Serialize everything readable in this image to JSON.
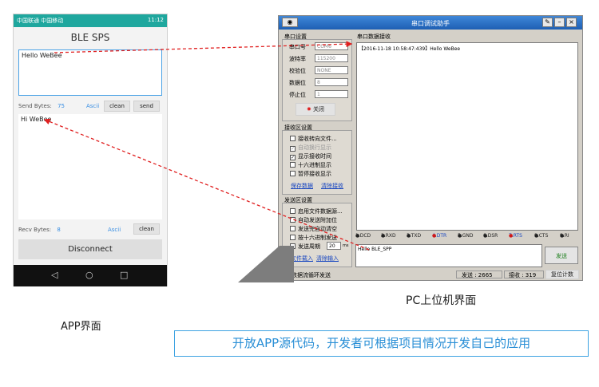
{
  "phone": {
    "status_left": "中国联通 中国移动",
    "status_right": "11:12",
    "title": "BLE SPS",
    "send_text": "Hello WeBee",
    "send_bytes_label": "Send Bytes:",
    "send_bytes_value": "75",
    "ascii_label": "Ascii",
    "clean_label": "clean",
    "send_label": "send",
    "recv_text": "Hi WeBee",
    "recv_bytes_label": "Recv Bytes:",
    "recv_bytes_value": "8",
    "recv_ascii_label": "Ascii",
    "recv_clean_label": "clean",
    "disconnect_label": "Disconnect",
    "nav": [
      "◁",
      "○",
      "□"
    ]
  },
  "app_label": "APP界面",
  "pc": {
    "title": "串口调试助手",
    "port_group": "串口设置",
    "port_label": "串口号",
    "port_value": "COM6",
    "baud_label": "波特率",
    "baud_value": "115200",
    "parity_label": "校验位",
    "parity_value": "NONE",
    "data_label": "数据位",
    "data_value": "8",
    "stop_label": "停止位",
    "stop_value": "1",
    "close_label": "关闭",
    "recv_group": "接收区设置",
    "recv_opts": [
      "接收转向文件...",
      "自动换行显示",
      "显示接收时间",
      "十六进制显示",
      "暂停接收显示"
    ],
    "recv_links": [
      "保存数据",
      "清除接收"
    ],
    "send_group": "发送区设置",
    "send_opts": [
      "启用文件数据源...",
      "自动发送附加位",
      "发送完自动清空",
      "按十六进制发送",
      "发送周期"
    ],
    "period_value": "20",
    "period_unit": "ms",
    "send_links": [
      "文件载入",
      "清除输入"
    ],
    "recv_area_title": "串口数据接收",
    "recv_content": "【2016-11-18 10:58:47:439】Hello WeBee",
    "pins": [
      "1.DCD",
      "2.RXD",
      "3.TXD",
      "4.DTR",
      "5.GND",
      "6.DSR",
      "7.RTS",
      "8.CTS",
      "9.RI"
    ],
    "send_content": "Hello BLE_SPP",
    "send_button": "发送",
    "status_text": "数据流循环发送",
    "sent_label": "发送 : 2665",
    "recv_label": "接收 : 319",
    "reset_label": "复位计数"
  },
  "pc_label": "PC上位机界面",
  "banner": "开放APP源代码，开发者可根据项目情况开发自己的应用"
}
